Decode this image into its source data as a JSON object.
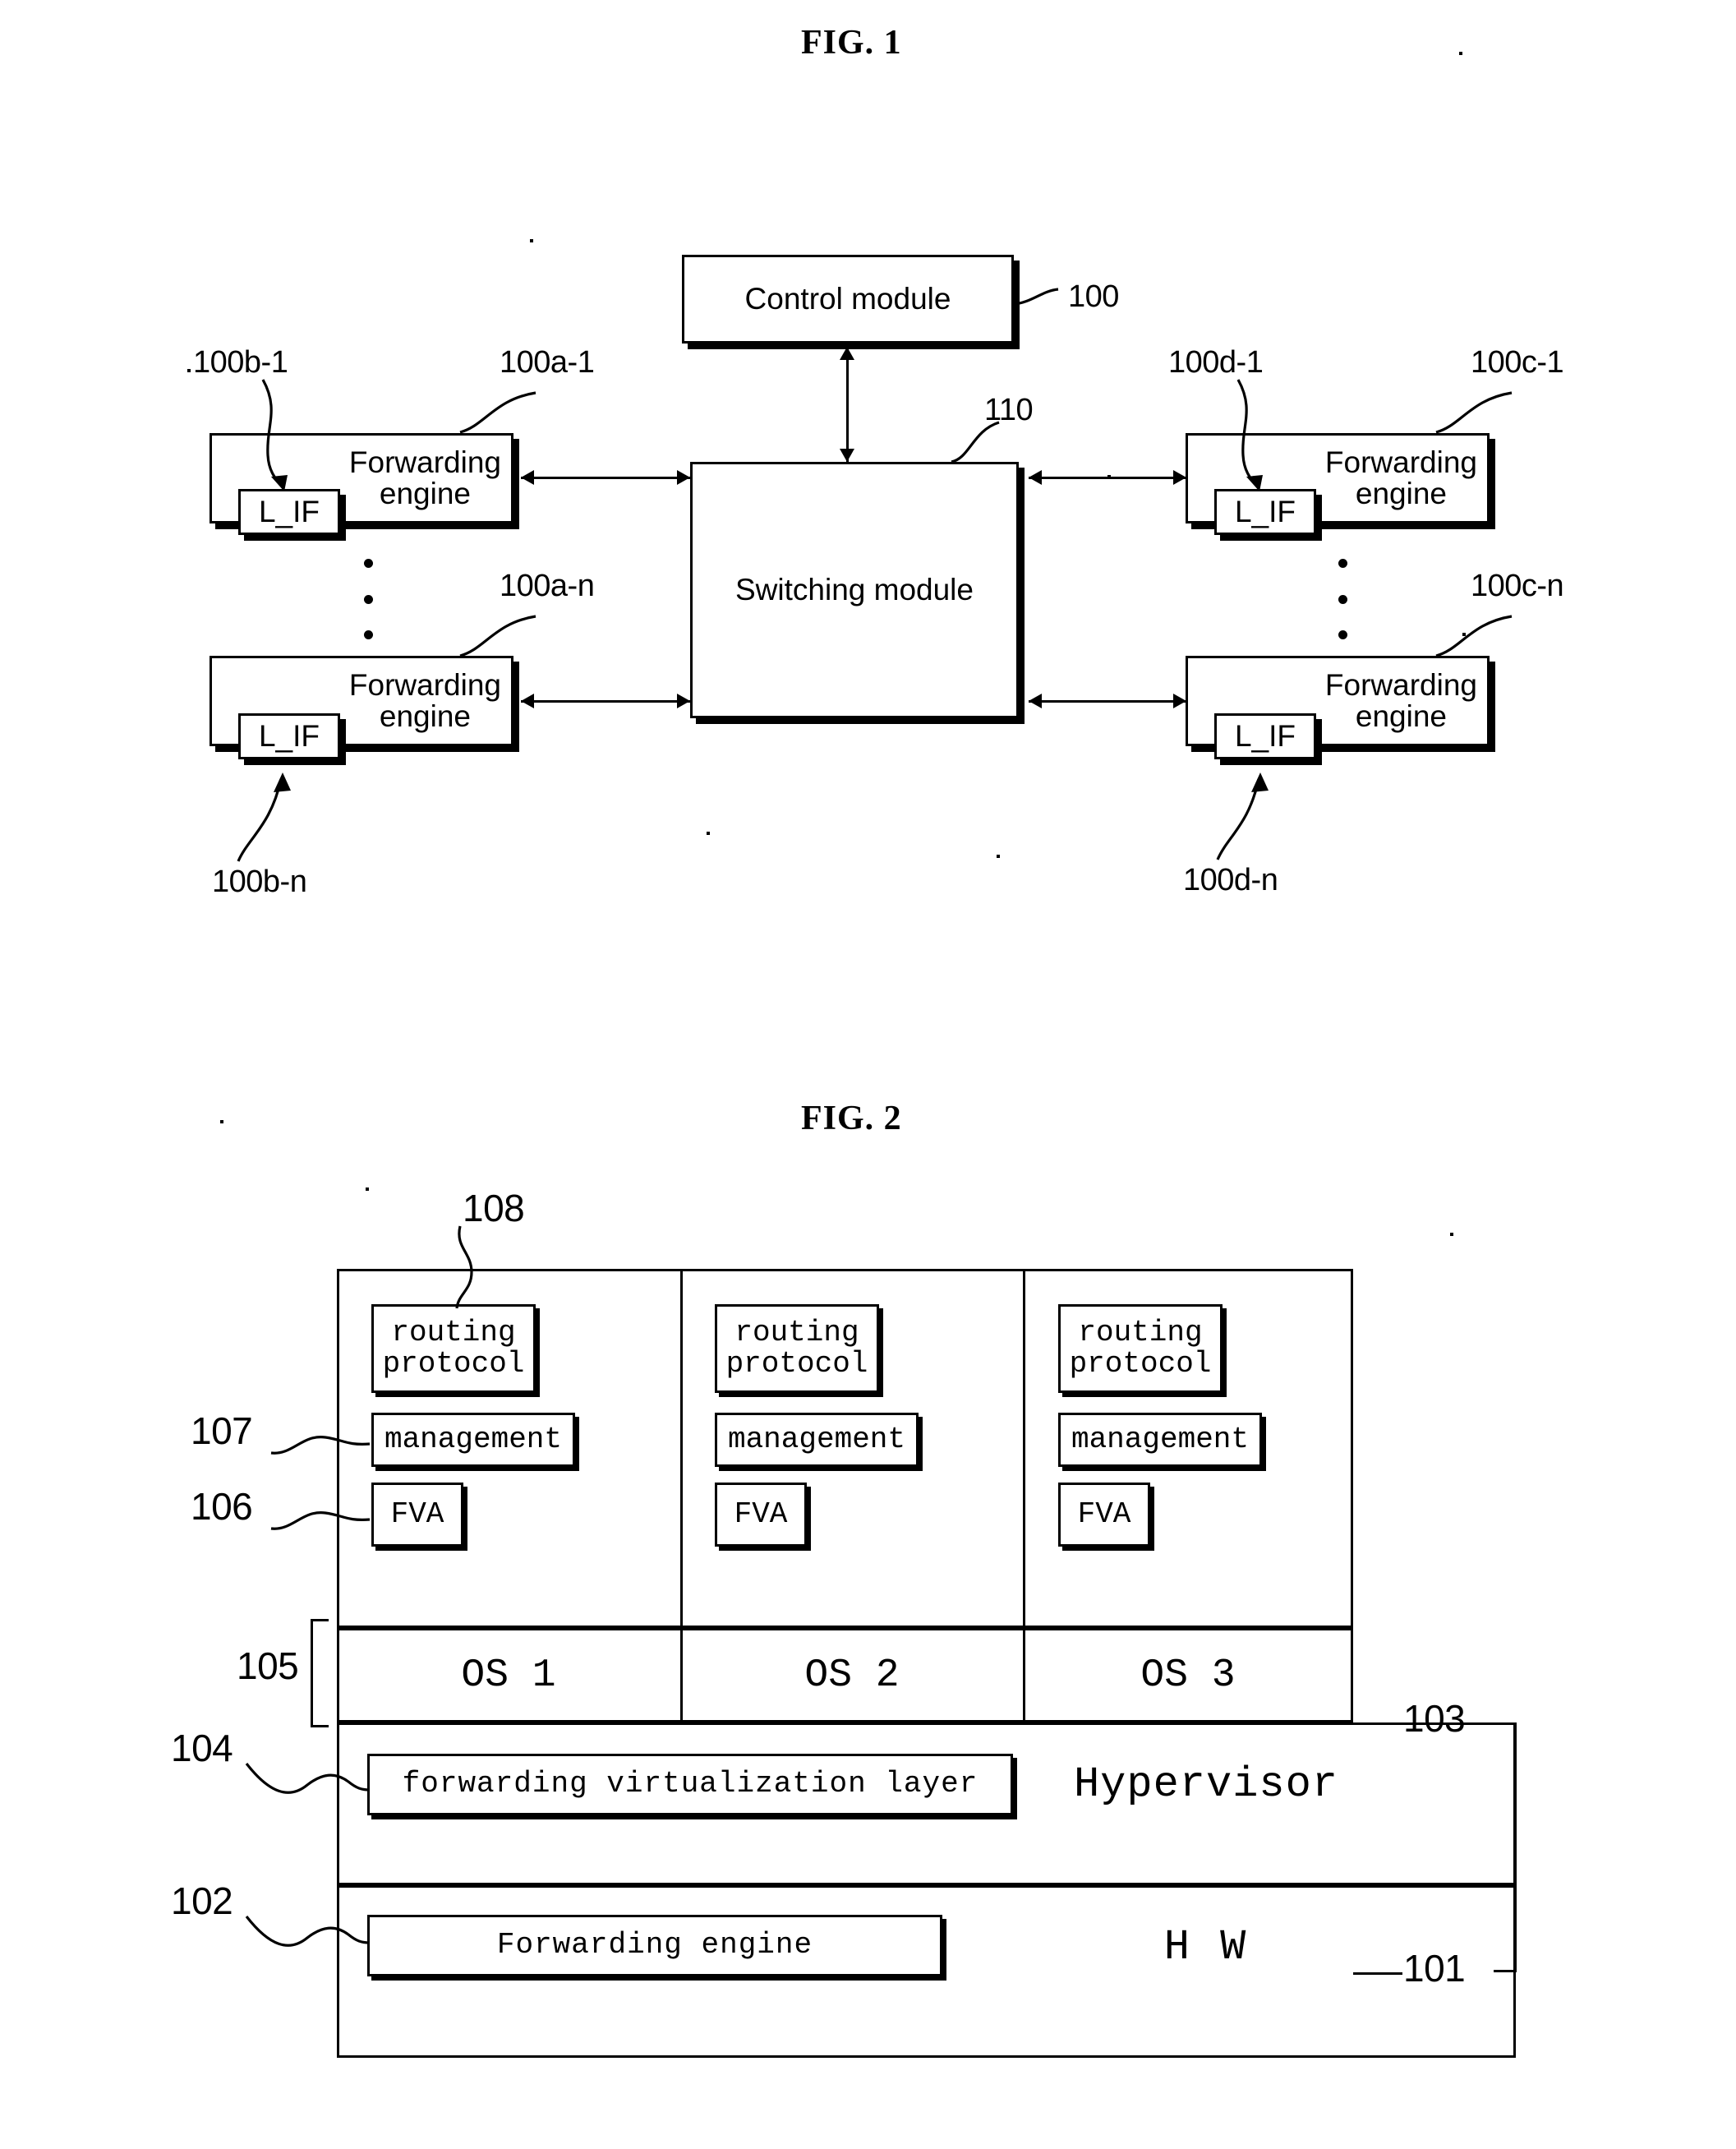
{
  "figures": [
    {
      "id": "fig1",
      "title": "FIG. 1",
      "nodes": {
        "control_module": "Control module",
        "switching_module": "Switching module",
        "forwarding_engine": "Forwarding\nengine",
        "line_interface": "L_IF"
      },
      "reference_numerals": {
        "control_module": "100",
        "switching_module": "110",
        "fe_left_top": "100a-1",
        "fe_left_bottom": "100a-n",
        "lif_left_top": "100b-1",
        "lif_left_bottom": "100b-n",
        "fe_right_top": "100c-1",
        "fe_right_bottom": "100c-n",
        "lif_right_top": "100d-1",
        "lif_right_bottom": "100d-n"
      }
    },
    {
      "id": "fig2",
      "title": "FIG. 2",
      "columns": [
        {
          "os": "OS 1",
          "routing_protocol": "routing\nprotocol",
          "management": "management",
          "fva": "FVA"
        },
        {
          "os": "OS 2",
          "routing_protocol": "routing\nprotocol",
          "management": "management",
          "fva": "FVA"
        },
        {
          "os": "OS 3",
          "routing_protocol": "routing\nprotocol",
          "management": "management",
          "fva": "FVA"
        }
      ],
      "layers": {
        "hypervisor": "Hypervisor",
        "hardware": "H W",
        "forwarding_virtualization_layer": "forwarding virtualization layer",
        "forwarding_engine": "Forwarding engine"
      },
      "reference_numerals": {
        "routing_protocol": "108",
        "management": "107",
        "fva": "106",
        "os_row": "105",
        "fvl": "104",
        "hypervisor": "103",
        "forwarding_engine": "102",
        "hardware": "101"
      }
    }
  ]
}
